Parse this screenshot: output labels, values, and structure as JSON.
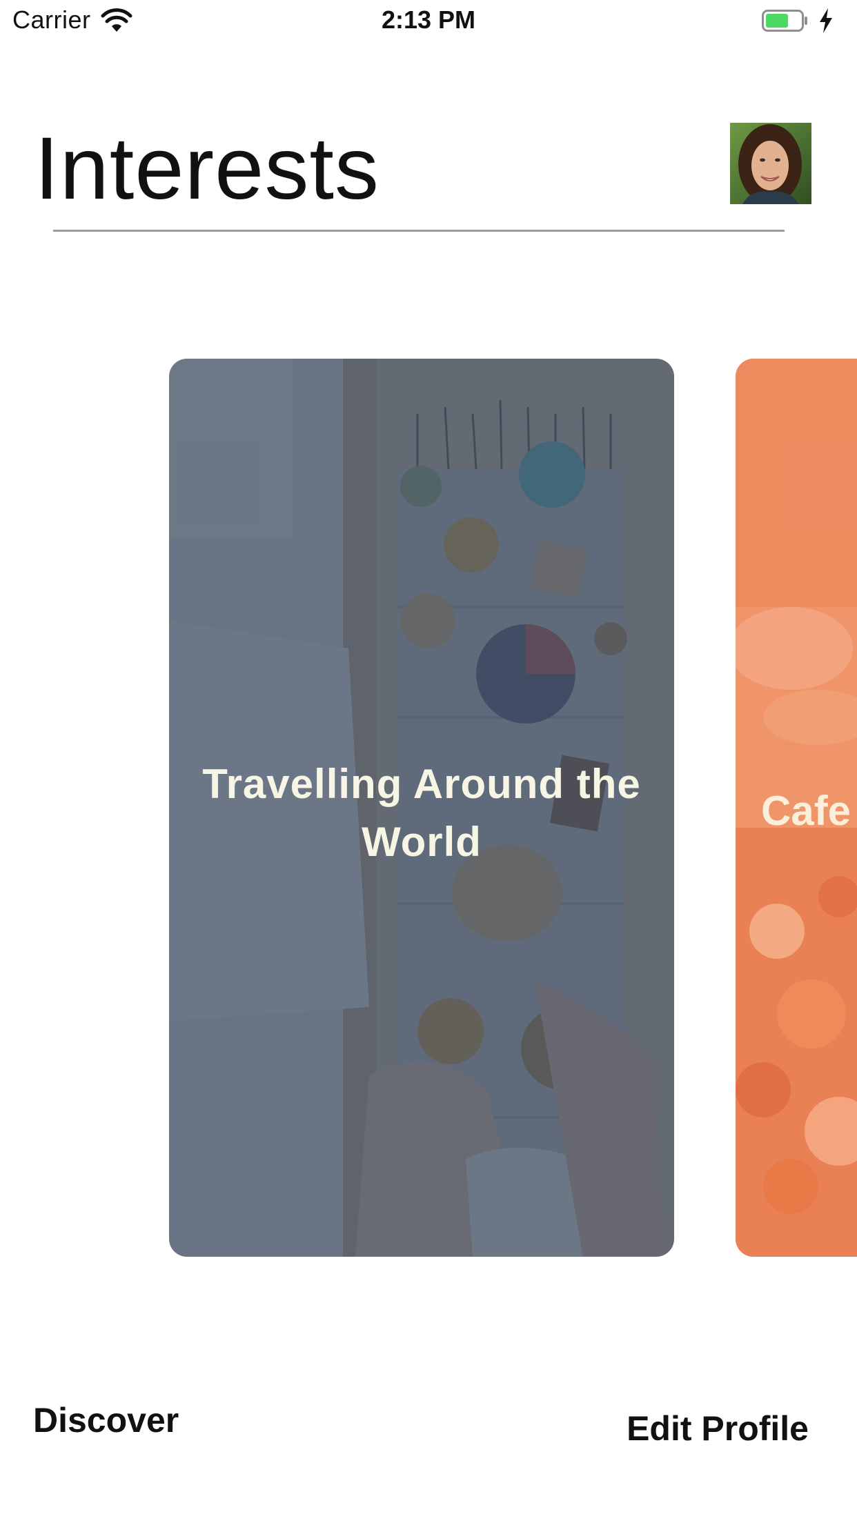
{
  "status_bar": {
    "carrier": "Carrier",
    "time": "2:13 PM",
    "icons": [
      "wifi-icon",
      "battery-icon",
      "charging-bolt-icon"
    ],
    "battery_color": "#4cd964"
  },
  "header": {
    "title": "Interests",
    "avatar": "profile-avatar"
  },
  "cards": [
    {
      "title": "Travelling Around the World",
      "overlay_color": "#4e5c6e"
    },
    {
      "title": "Cafe",
      "overlay_color": "#f08a5d"
    }
  ],
  "bottom_nav": {
    "discover": "Discover",
    "edit_profile": "Edit Profile"
  }
}
